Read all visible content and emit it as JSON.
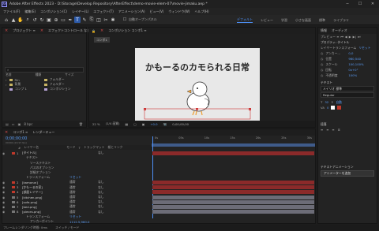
{
  "window": {
    "app_logo": "Ae",
    "title": "Adobe After Effects 2023 - D:\\Storage\\Develop Repository\\AfterEffect\\demo-movie-elem-07\\movie-jimaku.aep *",
    "controls": [
      "─",
      "☐",
      "✕"
    ]
  },
  "menu": [
    "ファイル(F)",
    "編集(E)",
    "コンポジション(C)",
    "レイヤー(L)",
    "エフェクト(T)",
    "アニメーション(A)",
    "ビュー(V)",
    "ウィンドウ(W)",
    "ヘルプ(H)"
  ],
  "toolbar": {
    "tools": [
      "home-icon",
      "selection-icon",
      "hand-icon",
      "zoom-icon",
      "orbit-icon",
      "rotate-icon",
      "camera-icon",
      "anchor-icon",
      "rect-icon",
      "pen-icon",
      "text-icon",
      "brush-icon",
      "stamp-icon",
      "eraser-icon",
      "roto-icon",
      "puppet-icon"
    ],
    "tool_glyphs": [
      "⌂",
      "▲",
      "✋",
      "🔍",
      "↺",
      "↻",
      "▣",
      "⊕",
      "▭",
      "✒",
      "T",
      "✎",
      "⎘",
      "◫",
      "✂",
      "✱"
    ],
    "snap_label": "自動オープンパネル",
    "workspaces": [
      "デフォルト",
      "レビュー",
      "学習",
      "小さな画面",
      "標準",
      "ライブラリ"
    ],
    "active_workspace": "デフォルト"
  },
  "project_panel": {
    "tabs": [
      "プロジェクト ≡",
      "エフェクトコントロール なし"
    ],
    "search_placeholder": "",
    "columns": [
      "名前",
      "種類",
      "サイズ"
    ],
    "items": [
      {
        "name": "Rin",
        "type": "フォルダー",
        "color": "#c8b464"
      },
      {
        "name": "背景",
        "type": "フォルダー",
        "color": "#c8b464"
      },
      {
        "name": "コンプ 1",
        "type": "コンポジション",
        "color": "#b7a3d6"
      }
    ],
    "footer_bpc": "8 bpc"
  },
  "comp_panel": {
    "tab": "コンポジション コンポ1 ≡",
    "sub_tab": "コンポ1",
    "canvas_title": "かもーるのカモられる日常",
    "footer": {
      "zoom": "22 %",
      "quality": "(1/4 画質)",
      "time": "0;00;00;00",
      "color_plus": "+0.0"
    }
  },
  "timeline": {
    "tabs": [
      "コンポ1 ≡",
      "レンダーキュー"
    ],
    "timecode": "0;00;00;00",
    "fps_text": "00000 (29.97 fps)",
    "columns": [
      "#",
      "レイヤー名",
      "モード",
      "T",
      "トラックマット",
      "親とリンク"
    ],
    "rows": [
      {
        "label": "[タイトル]",
        "indent": 1,
        "mode": "",
        "parent": "なし",
        "color": "#c0392b",
        "num": "1",
        "bar_color": "#8b2a2a"
      },
      {
        "label": "テキスト",
        "indent": 2,
        "mode": "",
        "parent": "",
        "color": "",
        "num": "",
        "bar_color": ""
      },
      {
        "label": "ソーステキスト",
        "indent": 3,
        "mode": "",
        "parent": "",
        "color": "",
        "num": "",
        "bar_color": ""
      },
      {
        "label": "パスのオプション",
        "indent": 3,
        "mode": "",
        "parent": "",
        "color": "",
        "num": "",
        "bar_color": ""
      },
      {
        "label": "詳細オプション",
        "indent": 3,
        "mode": "",
        "parent": "",
        "color": "",
        "num": "",
        "bar_color": ""
      },
      {
        "label": "トランスフォーム",
        "indent": 2,
        "mode": "リセット",
        "parent": "",
        "color": "",
        "num": "",
        "bar_color": ""
      },
      {
        "label": "[kamorun]",
        "indent": 1,
        "mode": "通常",
        "parent": "なし",
        "color": "#c0392b",
        "num": "2",
        "bar_color": "#8b2a2a"
      },
      {
        "label": "[かもーるの家]",
        "indent": 1,
        "mode": "通常",
        "parent": "なし",
        "color": "#c0392b",
        "num": "3",
        "bar_color": "#8b2a2a"
      },
      {
        "label": "[部屋レイヤー]",
        "indent": 1,
        "mode": "通常",
        "parent": "なし",
        "color": "#c0392b",
        "num": "4",
        "bar_color": "#8b2a2a"
      },
      {
        "label": "[kitchen.png]",
        "indent": 1,
        "mode": "通常",
        "parent": "なし",
        "color": "#777",
        "num": "5",
        "bar_color": "#6c6c77"
      },
      {
        "label": "[sofa.png]",
        "indent": 1,
        "mode": "通常",
        "parent": "なし",
        "color": "#777",
        "num": "6",
        "bar_color": "#6c6c77"
      },
      {
        "label": "[bed.png]",
        "indent": 1,
        "mode": "通常",
        "parent": "なし",
        "color": "#777",
        "num": "7",
        "bar_color": "#6c6c77"
      },
      {
        "label": "[pieces.png]",
        "indent": 1,
        "mode": "通常",
        "parent": "なし",
        "color": "#777",
        "num": "8",
        "bar_color": "#6c6c77"
      },
      {
        "label": "トランスフォーム",
        "indent": 2,
        "mode": "リセット",
        "parent": "",
        "color": "",
        "num": "",
        "bar_color": ""
      },
      {
        "label": "アンカーポイント",
        "indent": 3,
        "mode": "1112.5,960.0",
        "parent": "",
        "color": "",
        "num": "",
        "bar_color": ""
      }
    ],
    "ruler_labels": [
      "0s",
      "05s",
      "10s",
      "15s",
      "20s",
      "25s",
      "30s"
    ],
    "footer": "フレームレンダリング時間: 0ms",
    "footer_right": "スイッチ / モード"
  },
  "right_panel": {
    "tabs": [
      "情報",
      "オーディオ"
    ],
    "preview_tab": "プレビュー ≡",
    "properties_title": "プロパティ: タイトル",
    "transform_label": "レイヤートランスフォーム",
    "reset_label": "リセット",
    "props": [
      {
        "name": "アンカー…",
        "value": "0,0"
      },
      {
        "name": "位置",
        "value": "960,540"
      },
      {
        "name": "スケール",
        "value": "100,100%"
      },
      {
        "name": "回転",
        "value": "0x+0°"
      },
      {
        "name": "不透明度",
        "value": "100%"
      }
    ],
    "text_section": "テキスト",
    "font": "メイリオ 標準",
    "font_style": "Regular",
    "font_size": "32",
    "leading": "自動",
    "tracking": "0",
    "align_section": "段落",
    "text_anim": "テキストアニメーション",
    "anim_button": "アニメーターを追加"
  },
  "status_bar": {
    "render_time": "フレームレンダリング時間: 0ms",
    "mode_toggle": "スイッチ / モード"
  }
}
